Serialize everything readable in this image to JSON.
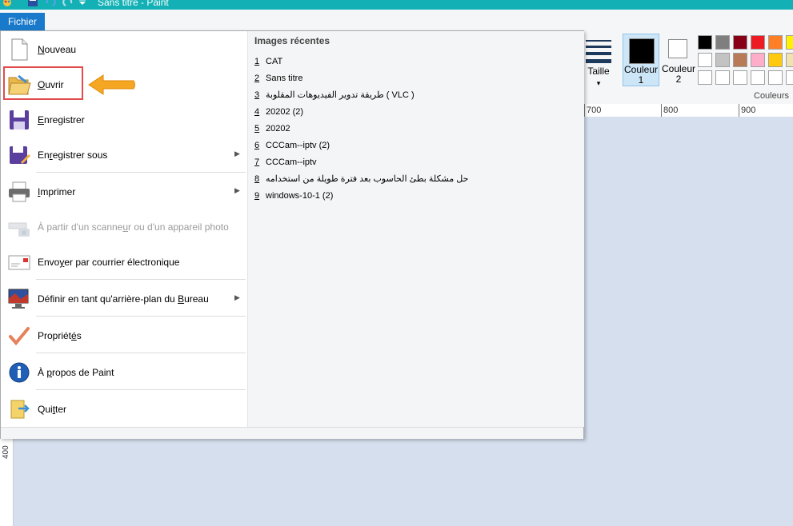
{
  "window": {
    "title": "Sans titre - Paint"
  },
  "file_tab": {
    "label": "Fichier"
  },
  "ribbon": {
    "size_label": "Taille",
    "color1_label": "Couleur 1",
    "color1_hex": "#000000",
    "color2_label": "Couleur 2",
    "color2_hex": "#ffffff",
    "colors_group_label": "Couleurs",
    "palette": [
      [
        "#000000",
        "#7f7f7f",
        "#880015",
        "#ed1c24",
        "#ff7f27",
        "#fff200"
      ],
      [
        "#ffffff",
        "#c3c3c3",
        "#b97a57",
        "#ffaec9",
        "#ffc90e",
        "#efe4b0"
      ],
      [
        "#ffffff",
        "#ffffff",
        "#ffffff",
        "#ffffff",
        "#ffffff",
        "#ffffff"
      ]
    ]
  },
  "ruler": {
    "h_ticks": [
      "700",
      "800",
      "900"
    ],
    "v_ticks": [
      "400"
    ]
  },
  "menu": {
    "items": [
      {
        "label_pre": "",
        "label_u": "N",
        "label_post": "ouveau",
        "icon": "new-document-icon",
        "disabled": false,
        "submenu": false
      },
      {
        "label_pre": "",
        "label_u": "O",
        "label_post": "uvrir",
        "icon": "open-folder-icon",
        "disabled": false,
        "submenu": false
      },
      {
        "label_pre": "",
        "label_u": "E",
        "label_post": "nregistrer",
        "icon": "save-disk-icon",
        "disabled": false,
        "submenu": false
      },
      {
        "label_pre": "En",
        "label_u": "r",
        "label_post": "egistrer sous",
        "icon": "save-as-icon",
        "disabled": false,
        "submenu": true
      },
      {
        "label_pre": "",
        "label_u": "I",
        "label_post": "mprimer",
        "icon": "printer-icon",
        "disabled": false,
        "submenu": true
      },
      {
        "label_pre": "À partir d'un scanne",
        "label_u": "u",
        "label_post": "r ou d'un appareil photo",
        "icon": "scanner-camera-icon",
        "disabled": true,
        "submenu": false
      },
      {
        "label_pre": "Envo",
        "label_u": "y",
        "label_post": "er par courrier électronique",
        "icon": "email-icon",
        "disabled": false,
        "submenu": false
      },
      {
        "label_pre": "Définir en tant qu'arrière-plan du ",
        "label_u": "B",
        "label_post": "ureau",
        "icon": "desktop-background-icon",
        "disabled": false,
        "submenu": true
      },
      {
        "label_pre": "Propriét",
        "label_u": "é",
        "label_post": "s",
        "icon": "checkmark-icon",
        "disabled": false,
        "submenu": false
      },
      {
        "label_pre": "À ",
        "label_u": "p",
        "label_post": "ropos de Paint",
        "icon": "info-icon",
        "disabled": false,
        "submenu": false
      },
      {
        "label_pre": "Qui",
        "label_u": "t",
        "label_post": "ter",
        "icon": "exit-icon",
        "disabled": false,
        "submenu": false
      }
    ],
    "recent_title": "Images récentes",
    "recent": [
      {
        "num": "1",
        "name": "CAT"
      },
      {
        "num": "2",
        "name": "Sans titre"
      },
      {
        "num": "3",
        "name": "طريقة تدوير الفيديوهات المقلوبة ( VLC )"
      },
      {
        "num": "4",
        "name": "20202 (2)"
      },
      {
        "num": "5",
        "name": "20202"
      },
      {
        "num": "6",
        "name": "CCCam--iptv (2)"
      },
      {
        "num": "7",
        "name": "CCCam--iptv"
      },
      {
        "num": "8",
        "name": "حل مشكلة بطئ الحاسوب بعد فترة طويلة من استخدامه"
      },
      {
        "num": "9",
        "name": "windows-10-1 (2)"
      }
    ]
  }
}
